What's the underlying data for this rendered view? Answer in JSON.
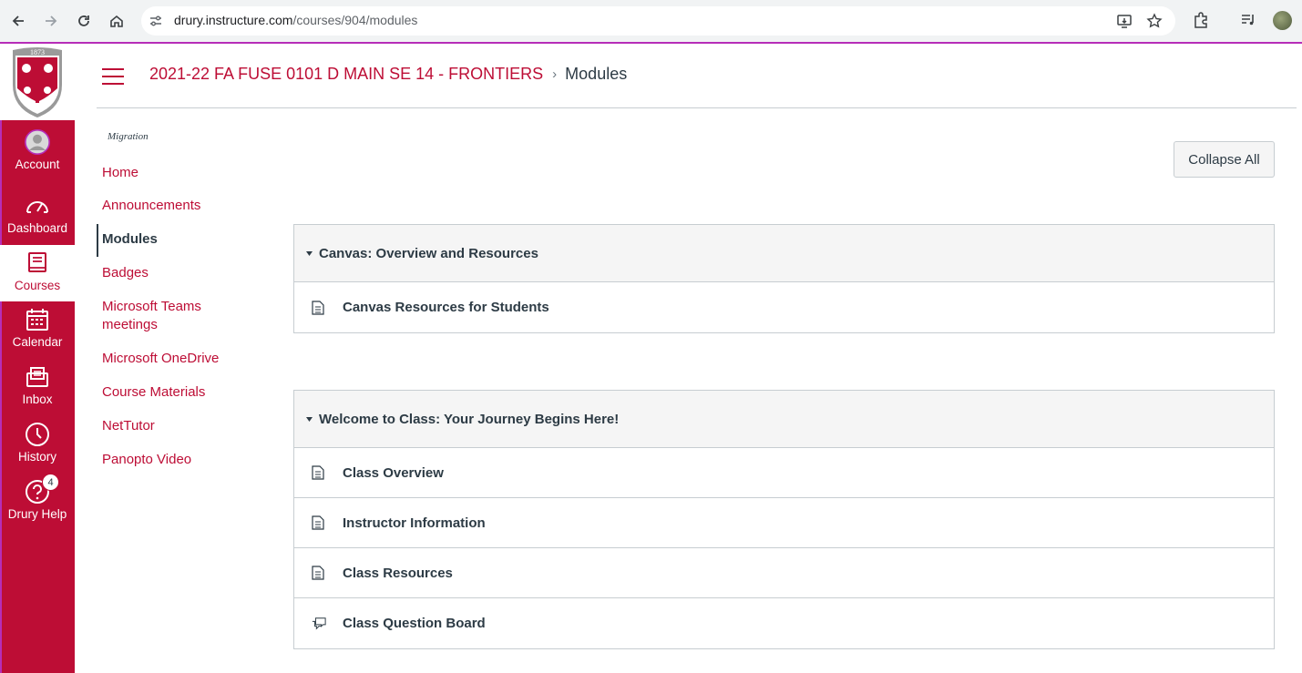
{
  "browser": {
    "url_domain": "drury.instructure.com",
    "url_path": "/courses/904/modules"
  },
  "global_nav": {
    "items": [
      {
        "label": "Account",
        "icon": "avatar-icon"
      },
      {
        "label": "Dashboard",
        "icon": "dashboard-icon"
      },
      {
        "label": "Courses",
        "icon": "courses-icon"
      },
      {
        "label": "Calendar",
        "icon": "calendar-icon"
      },
      {
        "label": "Inbox",
        "icon": "inbox-icon"
      },
      {
        "label": "History",
        "icon": "history-icon"
      },
      {
        "label": "Drury Help",
        "icon": "help-icon",
        "badge": "4"
      }
    ],
    "logo_year": "1873"
  },
  "header": {
    "course_name": "2021-22 FA FUSE 0101 D MAIN SE 14 - FRONTIERS",
    "separator": "›",
    "current_page": "Modules"
  },
  "course_nav": {
    "tag": "Migration",
    "items": [
      {
        "label": "Home"
      },
      {
        "label": "Announcements"
      },
      {
        "label": "Modules"
      },
      {
        "label": "Badges"
      },
      {
        "label": "Microsoft Teams meetings"
      },
      {
        "label": "Microsoft OneDrive"
      },
      {
        "label": "Course Materials"
      },
      {
        "label": "NetTutor"
      },
      {
        "label": "Panopto Video"
      }
    ]
  },
  "toolbar": {
    "collapse_label": "Collapse All"
  },
  "modules": [
    {
      "title": "Canvas: Overview and Resources",
      "items": [
        {
          "title": "Canvas Resources for Students",
          "icon": "page-icon"
        }
      ]
    },
    {
      "title": "Welcome to Class: Your Journey Begins Here!",
      "items": [
        {
          "title": "Class Overview",
          "icon": "page-icon"
        },
        {
          "title": "Instructor Information",
          "icon": "page-icon"
        },
        {
          "title": "Class Resources",
          "icon": "page-icon"
        },
        {
          "title": "Class Question Board",
          "icon": "discussion-icon"
        }
      ]
    }
  ],
  "colors": {
    "brand": "#bd0d35",
    "text": "#2d3b45",
    "border": "#c7cdd1",
    "accent_line": "#b62db8"
  }
}
